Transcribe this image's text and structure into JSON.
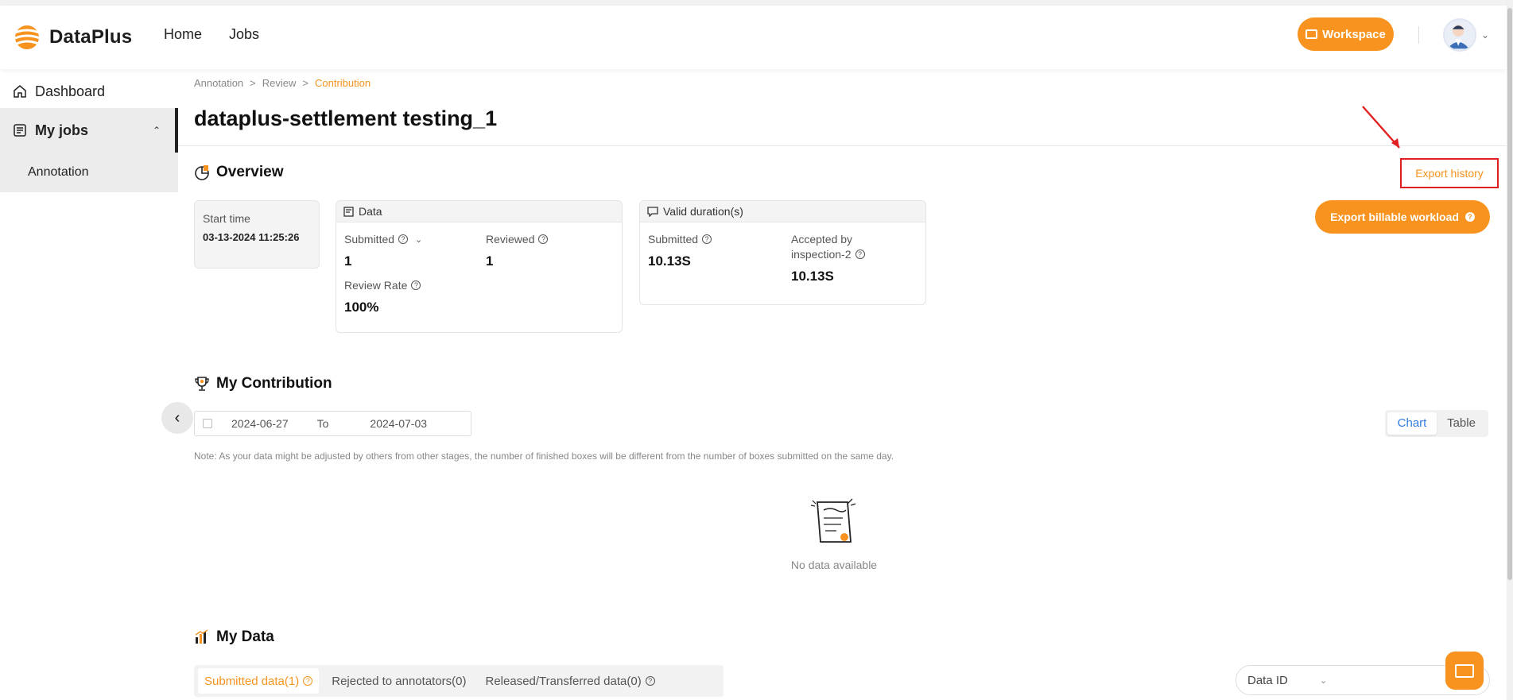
{
  "app": {
    "name": "DataPlus"
  },
  "nav": {
    "home": "Home",
    "jobs": "Jobs",
    "workspace": "Workspace"
  },
  "sidebar": {
    "dashboard": "Dashboard",
    "my_jobs": "My jobs",
    "annotation": "Annotation"
  },
  "breadcrumb": [
    "Annotation",
    "Review",
    "Contribution"
  ],
  "page": {
    "title": "dataplus-settlement testing_1"
  },
  "overview": {
    "title": "Overview",
    "export_history": "Export history",
    "export_billable": "Export billable workload",
    "start_time": {
      "label": "Start time",
      "value": "03-13-2024 11:25:26"
    },
    "data_card": {
      "title": "Data",
      "submitted": {
        "label": "Submitted",
        "value": "1"
      },
      "reviewed": {
        "label": "Reviewed",
        "value": "1"
      },
      "review_rate": {
        "label": "Review Rate",
        "value": "100%"
      }
    },
    "valid_card": {
      "title": "Valid duration(s)",
      "submitted": {
        "label": "Submitted",
        "value": "10.13S"
      },
      "accepted": {
        "label_1": "Accepted by",
        "label_2": "inspection-2",
        "value": "10.13S"
      }
    }
  },
  "contribution": {
    "title": "My Contribution",
    "date_from": "2024-06-27",
    "date_to_label": "To",
    "date_to": "2024-07-03",
    "view_chart": "Chart",
    "view_table": "Table",
    "active_view": "Chart",
    "note": "Note: As your data might be adjusted by others from other stages, the number of finished boxes will be different from the number of boxes submitted on the same day.",
    "empty_text": "No data available"
  },
  "my_data": {
    "title": "My Data",
    "tabs": [
      "Submitted data(1)",
      "Rejected to annotators(0)",
      "Released/Transferred data(0)"
    ],
    "active_tab": 0,
    "search_field": "Data ID"
  },
  "colors": {
    "accent": "#f7931e",
    "highlight": "#e02020",
    "link_blue": "#2f7de1"
  },
  "icons": [
    "home-icon",
    "jobs-icon",
    "chevron-up-icon",
    "chevron-down-icon",
    "overview-icon",
    "data-icon",
    "duration-icon",
    "help-icon",
    "trophy-icon",
    "calendar-icon",
    "chevron-left-icon",
    "bar-chart-icon",
    "mail-icon"
  ]
}
